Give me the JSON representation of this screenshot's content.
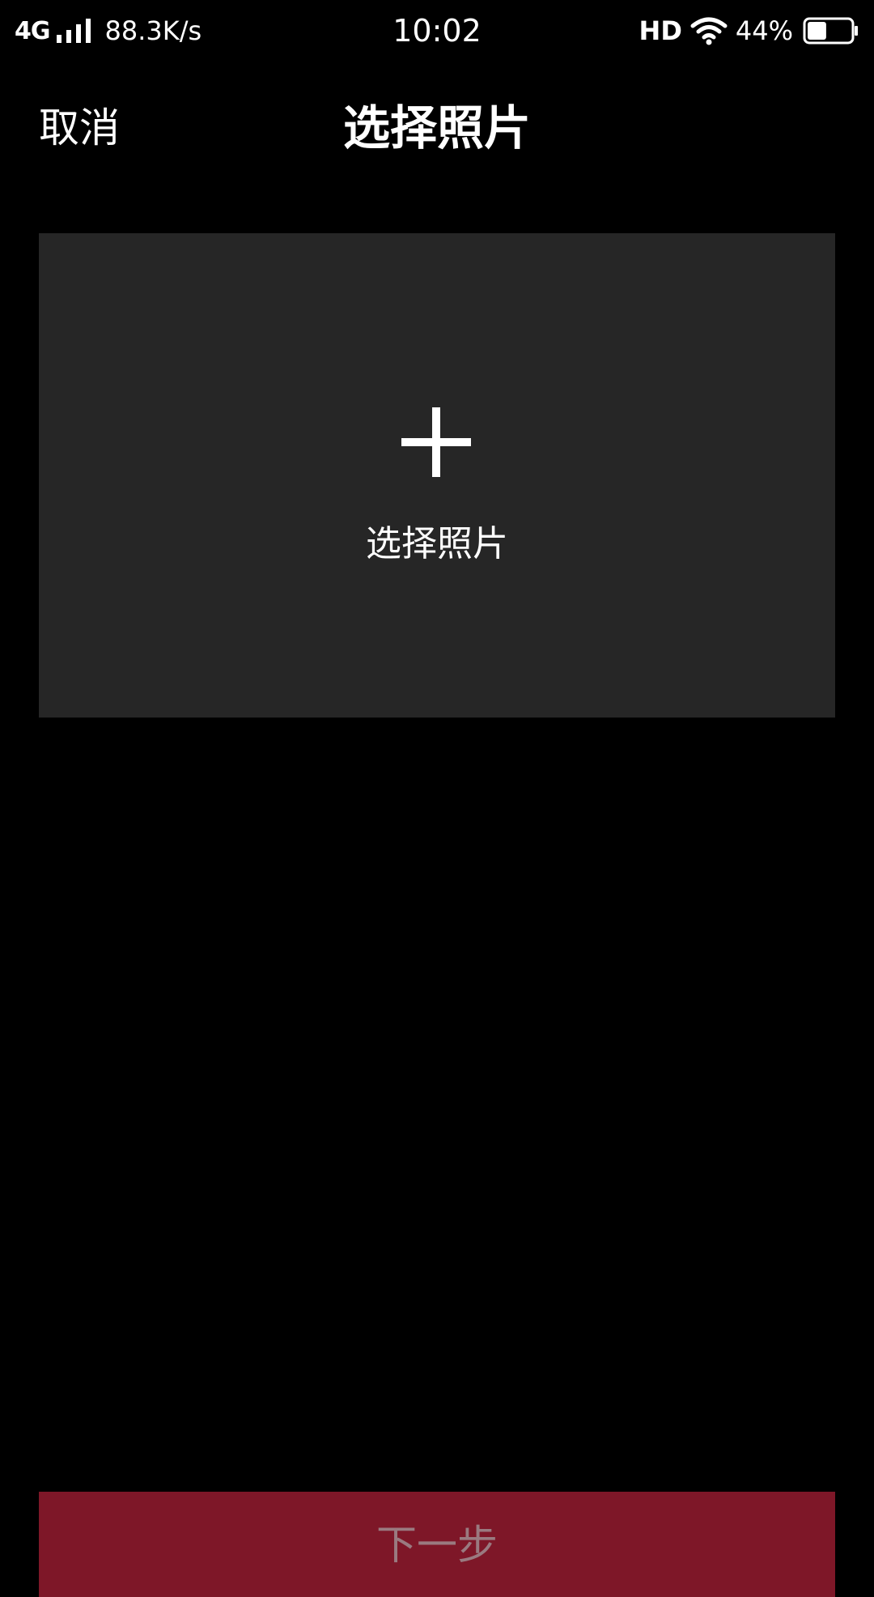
{
  "status_bar": {
    "network": "4G",
    "speed": "88.3K/s",
    "time": "10:02",
    "hd": "HD",
    "battery_percent": "44%",
    "battery_level": 0.44
  },
  "header": {
    "cancel_label": "取消",
    "title": "选择照片"
  },
  "picker": {
    "label": "选择照片",
    "icon": "plus-icon"
  },
  "footer": {
    "next_label": "下一步"
  },
  "colors": {
    "background": "#000000",
    "card": "#262626",
    "accent": "#7e1728"
  }
}
